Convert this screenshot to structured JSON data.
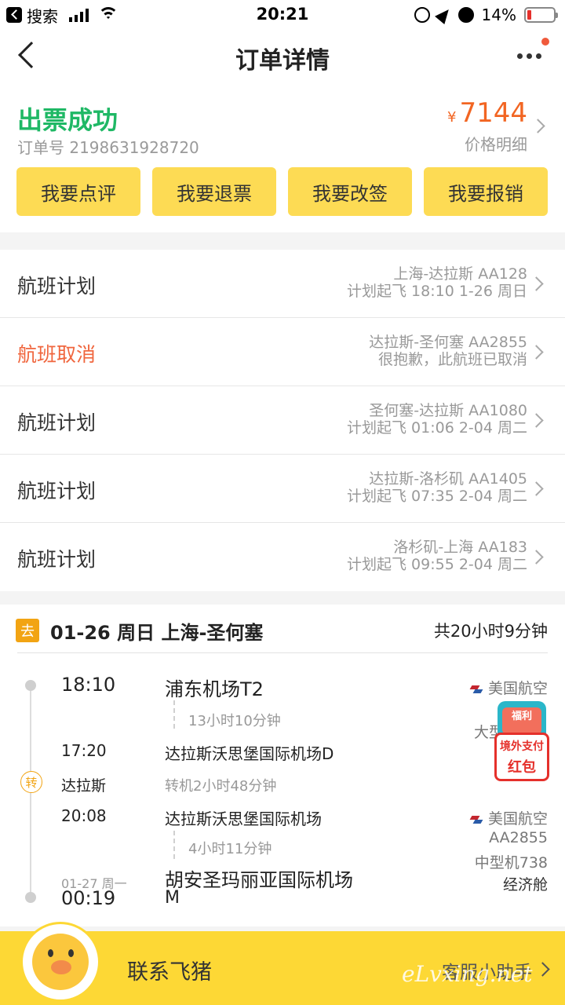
{
  "status_bar": {
    "back_app": "搜索",
    "time": "20:21",
    "battery": "14%"
  },
  "nav": {
    "title": "订单详情"
  },
  "order": {
    "status": "出票成功",
    "order_no": "订单号 2198631928720",
    "currency": "¥",
    "price": "7144",
    "price_detail": "价格明细"
  },
  "actions": [
    "我要点评",
    "我要退票",
    "我要改签",
    "我要报销"
  ],
  "flights": [
    {
      "label": "航班计划",
      "route": "上海-达拉斯 AA128",
      "detail": "计划起飞 18:10 1-26 周日",
      "cancelled": false
    },
    {
      "label": "航班取消",
      "route": "达拉斯-圣何塞 AA2855",
      "detail": "很抱歉，此航班已取消",
      "cancelled": true
    },
    {
      "label": "航班计划",
      "route": "圣何塞-达拉斯 AA1080",
      "detail": "计划起飞 01:06 2-04 周二",
      "cancelled": false
    },
    {
      "label": "航班计划",
      "route": "达拉斯-洛杉矶 AA1405",
      "detail": "计划起飞 07:35 2-04 周二",
      "cancelled": false
    },
    {
      "label": "航班计划",
      "route": "洛杉矶-上海 AA183",
      "detail": "计划起飞 09:55 2-04 周二",
      "cancelled": false
    }
  ],
  "itinerary": {
    "tag": "去",
    "title": "01-26 周日 上海-圣何塞",
    "total": "共20小时9分钟",
    "seg1": {
      "dep_time": "18:10",
      "dep_airport": "浦东机场T2",
      "duration": "13小时10分钟",
      "arr_time": "17:20",
      "arr_airport": "达拉斯沃思堡国际机场D",
      "airline": "美国航空",
      "aircraft_partial": "大型"
    },
    "transfer": {
      "icon": "转",
      "city": "达拉斯",
      "wait": "转机2小时48分钟"
    },
    "seg2": {
      "dep_time": "20:08",
      "dep_airport": "达拉斯沃思堡国际机场",
      "duration": "4小时11分钟",
      "arr_date": "01-27 周一",
      "arr_time": "00:19",
      "arr_airport_line1": "胡安圣玛丽亚国际机场",
      "arr_airport_line2": "M",
      "airline": "美国航空",
      "flight_no": "AA2855",
      "aircraft": "中型机738",
      "cabin": "经济舱"
    }
  },
  "promo": {
    "line1": "福利",
    "line2": "境外支付",
    "line3": "红包"
  },
  "bottom": {
    "contact": "联系飞猪",
    "helper": "客服小助手"
  },
  "watermark": "eLvxing.net",
  "colors": {
    "success": "#1fb865",
    "price": "#f26522",
    "cancel": "#f0663e",
    "button": "#fddb54",
    "tag": "#f2a413"
  }
}
